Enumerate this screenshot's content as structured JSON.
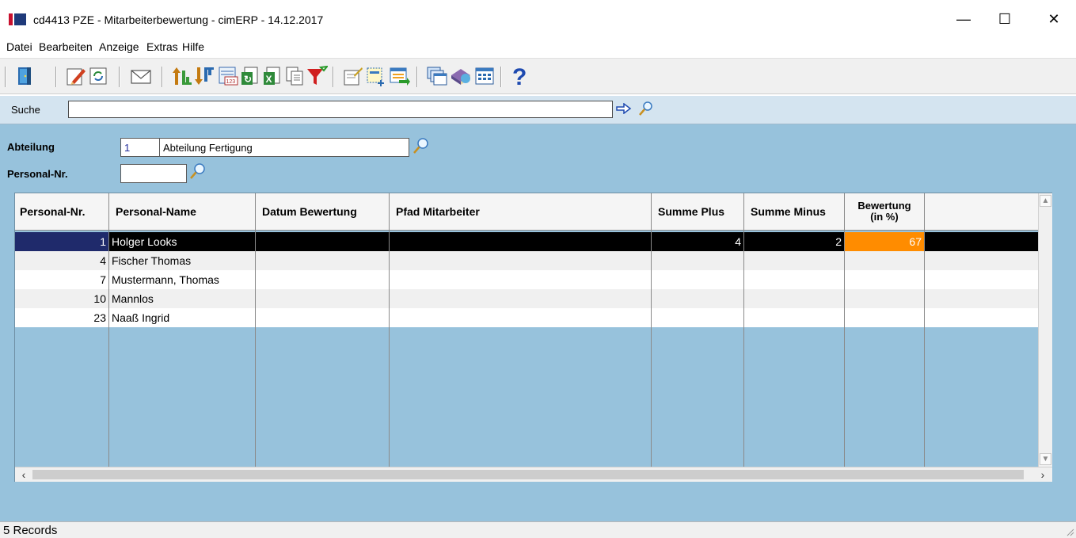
{
  "window": {
    "title": "cd4413 PZE - Mitarbeiterbewertung - cimERP - 14.12.2017",
    "minimize_glyph": "—",
    "maximize_glyph": "☐",
    "close_glyph": "✕"
  },
  "menu": [
    "Datei",
    "Bearbeiten",
    "Anzeige",
    "Extras",
    "Hilfe"
  ],
  "toolbar": {
    "icons": [
      "exit-door-icon",
      "edit-pencil-icon",
      "refresh-icon",
      "mail-icon",
      "sort-ascending-icon",
      "sort-descending-icon",
      "number-format-icon",
      "export-green-icon",
      "excel-export-icon",
      "copy-icon",
      "filter-icon",
      "properties-icon",
      "add-field-icon",
      "import-icon",
      "windows-icon",
      "book-icon",
      "grid-layout-icon",
      "help-icon"
    ]
  },
  "search": {
    "label": "Suche",
    "value": ""
  },
  "filters": {
    "abteilung_label": "Abteilung",
    "abteilung_nr": "1",
    "abteilung_name": "Abteilung Fertigung",
    "personal_label": "Personal-Nr.",
    "personal_value": ""
  },
  "table": {
    "columns": [
      "Personal-Nr.",
      "Personal-Name",
      "Datum Bewertung",
      "Pfad Mitarbeiter",
      "Summe Plus",
      "Summe Minus",
      "Bewertung\n(in %)",
      ""
    ],
    "rows": [
      {
        "nr": "1",
        "name": "Holger Looks",
        "datum": "",
        "pfad": "",
        "plus": "4",
        "minus": "2",
        "bewertung": "67",
        "selected": true
      },
      {
        "nr": "4",
        "name": "Fischer Thomas",
        "datum": "",
        "pfad": "",
        "plus": "",
        "minus": "",
        "bewertung": ""
      },
      {
        "nr": "7",
        "name": "Mustermann, Thomas",
        "datum": "",
        "pfad": "",
        "plus": "",
        "minus": "",
        "bewertung": ""
      },
      {
        "nr": "10",
        "name": "Mannlos",
        "datum": "",
        "pfad": "",
        "plus": "",
        "minus": "",
        "bewertung": ""
      },
      {
        "nr": "23",
        "name": "Naaß Ingrid",
        "datum": "",
        "pfad": "",
        "plus": "",
        "minus": "",
        "bewertung": ""
      }
    ]
  },
  "status": {
    "text": "5 Records"
  },
  "colors": {
    "panel_bg": "#97c2dc",
    "selected_row": "#000000",
    "highlight_cell": "#ff8c00",
    "search_strip": "#d4e4f0"
  }
}
